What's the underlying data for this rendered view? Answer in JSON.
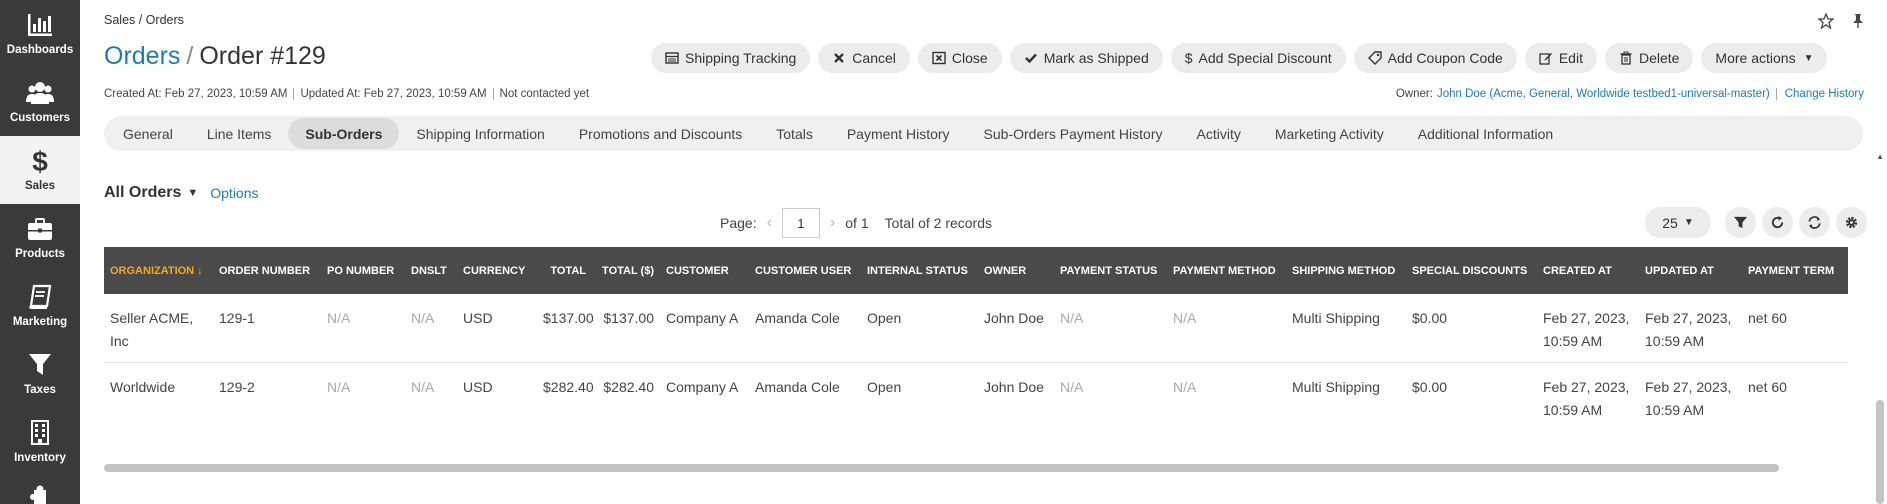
{
  "sidebar": {
    "items": [
      {
        "label": "Dashboards",
        "icon": "bar-chart-icon"
      },
      {
        "label": "Customers",
        "icon": "users-icon"
      },
      {
        "label": "Sales",
        "icon": "dollar-icon"
      },
      {
        "label": "Products",
        "icon": "briefcase-icon"
      },
      {
        "label": "Marketing",
        "icon": "book-icon"
      },
      {
        "label": "Taxes",
        "icon": "filter-icon"
      },
      {
        "label": "Inventory",
        "icon": "building-icon"
      }
    ]
  },
  "breadcrumb": "Sales / Orders",
  "title": {
    "parent": "Orders",
    "separator": "/",
    "current": "Order #129"
  },
  "actions": {
    "shipping_tracking": "Shipping Tracking",
    "cancel": "Cancel",
    "close": "Close",
    "mark_as_shipped": "Mark as Shipped",
    "add_special_discount": "Add Special Discount",
    "add_coupon_code": "Add Coupon Code",
    "edit": "Edit",
    "delete": "Delete",
    "more_actions": "More actions"
  },
  "meta": {
    "created": "Created At: Feb 27, 2023, 10:59 AM",
    "updated": "Updated At: Feb 27, 2023, 10:59 AM",
    "contacted": "Not contacted yet"
  },
  "owner": {
    "label": "Owner:",
    "value": "John Doe (Acme, General, Worldwide testbed1-universal-master)",
    "change_history": "Change History"
  },
  "tabs": [
    "General",
    "Line Items",
    "Sub-Orders",
    "Shipping Information",
    "Promotions and Discounts",
    "Totals",
    "Payment History",
    "Sub-Orders Payment History",
    "Activity",
    "Marketing Activity",
    "Additional Information"
  ],
  "active_tab": "Sub-Orders",
  "grid": {
    "view_name": "All Orders",
    "options_label": "Options",
    "pager": {
      "page_label": "Page:",
      "page": "1",
      "of_label": "of 1",
      "total": "Total of 2 records"
    },
    "page_size": "25",
    "columns": [
      "ORGANIZATION",
      "ORDER NUMBER",
      "PO NUMBER",
      "DNSLT",
      "CURRENCY",
      "TOTAL",
      "TOTAL ($)",
      "CUSTOMER",
      "CUSTOMER USER",
      "INTERNAL STATUS",
      "OWNER",
      "PAYMENT STATUS",
      "PAYMENT METHOD",
      "SHIPPING METHOD",
      "SPECIAL DISCOUNTS",
      "CREATED AT",
      "UPDATED AT",
      "PAYMENT TERM"
    ],
    "rows": [
      [
        "Seller ACME, Inc",
        "129-1",
        "N/A",
        "N/A",
        "USD",
        "$137.00",
        "$137.00",
        "Company A",
        "Amanda Cole",
        "Open",
        "John Doe",
        "N/A",
        "N/A",
        "Multi Shipping",
        "$0.00",
        "Feb 27, 2023, 10:59 AM",
        "Feb 27, 2023, 10:59 AM",
        "net 60"
      ],
      [
        "Worldwide",
        "129-2",
        "N/A",
        "N/A",
        "USD",
        "$282.40",
        "$282.40",
        "Company A",
        "Amanda Cole",
        "Open",
        "John Doe",
        "N/A",
        "N/A",
        "Multi Shipping",
        "$0.00",
        "Feb 27, 2023, 10:59 AM",
        "Feb 27, 2023, 10:59 AM",
        "net 60"
      ]
    ]
  },
  "colors": {
    "sidebar_bg": "#3a3a3a",
    "link": "#1f7bb0",
    "header_bg": "#4a4a4a",
    "sort_accent": "#f6a623"
  }
}
